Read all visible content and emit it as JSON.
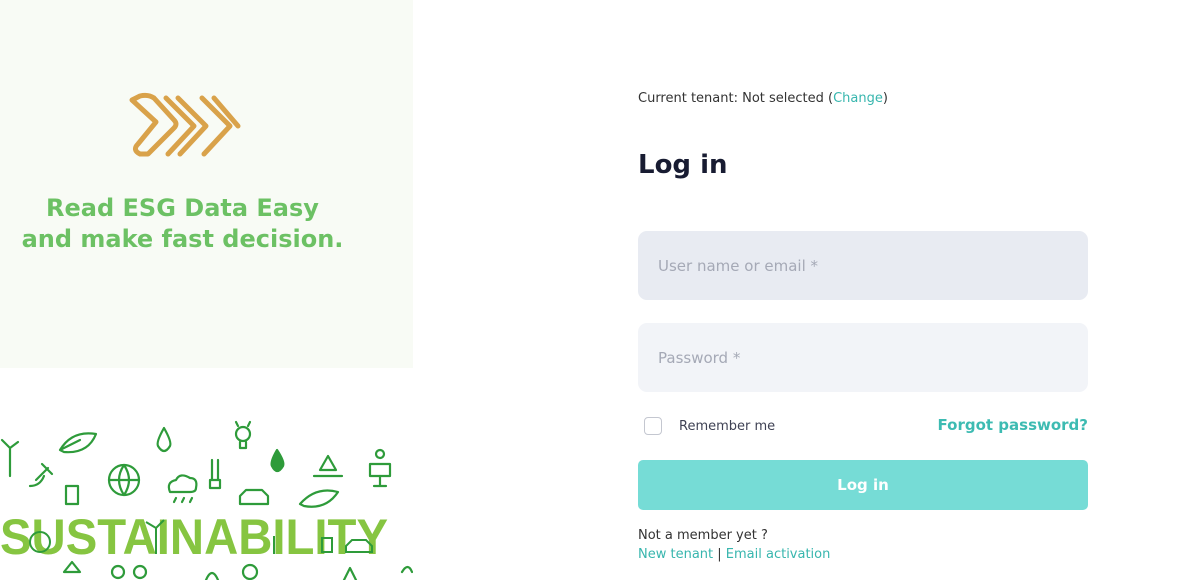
{
  "brand": {
    "tagline_line1": "Read ESG Data Easy",
    "tagline_line2": "and make fast decision.",
    "banner_word": "SUSTAINABILITY"
  },
  "tenant": {
    "prefix": "Current tenant: Not selected (",
    "change_label": "Change",
    "suffix": ")"
  },
  "form": {
    "title": "Log in",
    "username_placeholder": "User name or email *",
    "password_placeholder": "Password *",
    "remember_label": "Remember me",
    "forgot_label": "Forgot password?",
    "submit_label": "Log in"
  },
  "footer": {
    "not_member": "Not a member yet ?",
    "new_tenant": "New tenant",
    "separator": " | ",
    "email_activation": "Email activation"
  },
  "colors": {
    "accent": "#3dbbb2",
    "brand_green": "#6cc164",
    "logo_gold": "#d9a24a",
    "button": "#76dcd6"
  }
}
